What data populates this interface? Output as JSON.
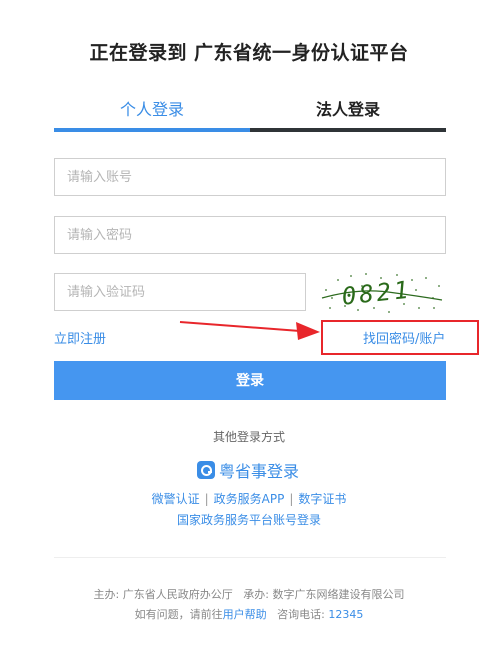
{
  "title": "正在登录到 广东省统一身份认证平台",
  "tabs": {
    "personal": "个人登录",
    "legal": "法人登录"
  },
  "form": {
    "account_placeholder": "请输入账号",
    "password_placeholder": "请输入密码",
    "captcha_placeholder": "请输入验证码",
    "captcha_text": "0821"
  },
  "links": {
    "register": "立即注册",
    "forgot": "找回密码/账户"
  },
  "login_button": "登录",
  "other_methods": {
    "heading": "其他登录方式",
    "yss_label": "粤省事登录",
    "wechat_police": "微警认证",
    "sep": "|",
    "gov_app": "政务服务APP",
    "digital_cert": "数字证书",
    "national": "国家政务服务平台账号登录"
  },
  "footer": {
    "sponsor": "主办: 广东省人民政府办公厅",
    "operator": "承办: 数字广东网络建设有限公司",
    "question_prefix": "如有问题，请前往",
    "help_link": "用户帮助",
    "phone_label": "咨询电话:",
    "phone": "12345"
  },
  "colors": {
    "accent": "#3a8de6",
    "button": "#4596f0",
    "highlight": "#e8262b"
  }
}
